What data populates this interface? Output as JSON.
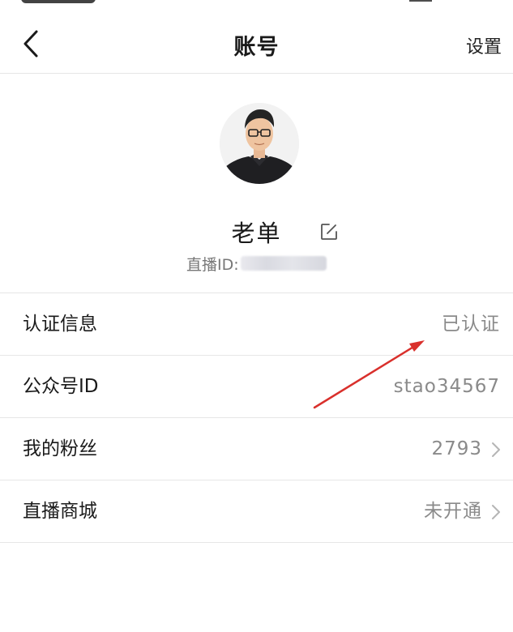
{
  "nav": {
    "title": "账号",
    "settings_label": "设置"
  },
  "profile": {
    "nickname": "老单",
    "live_id_label": "直播ID:",
    "live_id_value": "**********"
  },
  "list": {
    "rows": [
      {
        "label": "认证信息",
        "value": "已认证",
        "has_chevron": false
      },
      {
        "label": "公众号ID",
        "value": "stao34567",
        "has_chevron": false
      },
      {
        "label": "我的粉丝",
        "value": "2793",
        "has_chevron": true
      },
      {
        "label": "直播商城",
        "value": "未开通",
        "has_chevron": true
      }
    ]
  },
  "colors": {
    "text_primary": "#1a1a1a",
    "text_secondary": "#8a8a8a",
    "divider": "#e6e6e6",
    "annotation_arrow": "#d9302c"
  },
  "icons": {
    "back": "chevron-left-icon",
    "edit": "edit-icon",
    "row_chevron": "chevron-right-icon"
  }
}
